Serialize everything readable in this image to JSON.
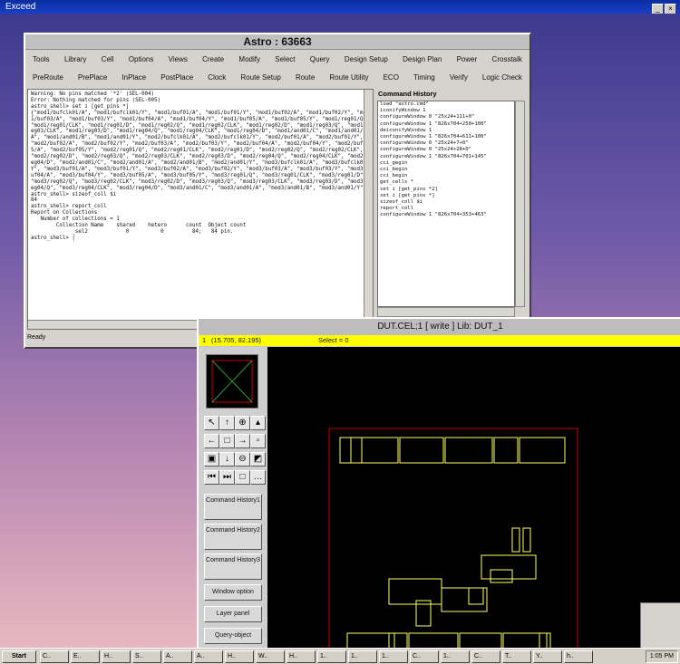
{
  "system_bar": {
    "title": "Exceed"
  },
  "astro": {
    "title": "Astro : 63663",
    "menu_row1": [
      "Tools",
      "Library",
      "Cell",
      "Options",
      "Views",
      "Create",
      "Modify",
      "Select",
      "Query",
      "Design Setup",
      "Design Plan",
      "Power",
      "Crosstalk"
    ],
    "menu_row2": [
      "PreRoute",
      "PrePlace",
      "InPlace",
      "PostPlace",
      "Clock",
      "Route Setup",
      "Route",
      "Route Utility",
      "ECO",
      "Timing",
      "Verify",
      "Logic Check"
    ],
    "console_text": "Warning: No pins matched '*2' (SEL-004)\nError: Nothing matched for pins (SEL-005)\nastro_shell> set i [get_pins *]\n{\"mod1/bufclk01/A\", \"mod1/bufclk01/Y\", \"mod1/buf01/A\", \"mod1/buf01/Y\", \"mod1/buf02/A\", \"mod1/buf02/Y\", \"mod1/buf03/A\", \"mod1/buf03/Y\", \"mod1/buf04/A\", \"mod1/buf04/Y\", \"mod1/buf05/A\", \"mod1/buf05/Y\", \"mod1/reg01/Q\", \"mod1/reg01/CLK\", \"mod1/reg01/D\", \"mod1/reg02/Q\", \"mod1/reg02/CLK\", \"mod1/reg02/D\", \"mod1/reg03/Q\", \"mod1/reg03/CLK\", \"mod1/reg03/D\", \"mod1/reg04/Q\", \"mod1/reg04/CLK\", \"mod1/reg04/D\", \"mod1/and01/C\", \"mod1/and01/A\", \"mod1/and01/B\", \"mod1/and01/Y\", \"mod2/bufclk01/A\", \"mod2/bufclk01/Y\", \"mod2/buf01/A\", \"mod2/buf01/Y\", \"mod2/buf02/A\", \"mod2/buf02/Y\", \"mod2/buf03/A\", \"mod2/buf03/Y\", \"mod2/buf04/A\", \"mod2/buf04/Y\", \"mod2/buf05/A\", \"mod2/buf05/Y\", \"mod2/reg01/Q\", \"mod2/reg01/CLK\", \"mod2/reg01/D\", \"mod2/reg02/Q\", \"mod2/reg02/CLK\", \"mod2/reg02/D\", \"mod2/reg03/Q\", \"mod2/reg03/CLK\", \"mod2/reg03/D\", \"mod2/reg04/Q\", \"mod2/reg04/CLK\", \"mod2/reg04/D\", \"mod2/and01/C\", \"mod2/and01/A\", \"mod2/and01/B\", \"mod2/and01/Y\", \"mod3/bufclk01/A\", \"mod3/bufclk01/Y\", \"mod3/buf01/A\", \"mod3/buf01/Y\", \"mod3/buf02/A\", \"mod3/buf02/Y\", \"mod3/buf03/A\", \"mod3/buf03/Y\", \"mod3/buf04/A\", \"mod3/buf04/Y\", \"mod3/buf05/A\", \"mod3/buf05/Y\", \"mod3/reg01/Q\", \"mod3/reg01/CLK\", \"mod3/reg01/D\", \"mod3/reg02/Q\", \"mod3/reg02/CLK\", \"mod3/reg02/D\", \"mod3/reg03/Q\", \"mod3/reg03/CLK\", \"mod3/reg03/D\", \"mod3/reg04/Q\", \"mod3/reg04/CLK\", \"mod3/reg04/D\", \"mod3/and01/C\", \"mod3/and01/A\", \"mod3/and01/B\", \"mod3/and01/Y\"}\nastro_shell> sizeof_coll $i\n84\nastro_shell> report_coll\nReport on Collections\n   Number of collections = 1\n        Collection Name    shared    hetero      count  Object count\n             _sel2            0          0         84;   84 pin.\nastro_shell> |",
    "history_label": "Command History",
    "history": [
      "load \"astro.cmd\"",
      "iconifyWindow 1",
      "configureWindow 0 \"25x24+111+0\"",
      "configureWindow 1 \"826x704+250+100\"",
      "deiconifyWindow 1",
      "configureWindow 1 \"826x704+611+100\"",
      "configureWindow 0 \"25x24+7+0\"",
      "configureWindow 0 \"25x24+28+0\"",
      "configureWindow 1 \"826x704+701+145\"",
      "cci_gegin",
      "cci_begin",
      "cci_begin",
      "get_cells *",
      "set i [get_pins *2]",
      "set i [get_pins *]",
      "sizeof_coll $i",
      "report_coll",
      "configureWindow 1 \"826x704+353+463\""
    ],
    "status": "Ready"
  },
  "dut": {
    "title": "DUT.CEL;1     [ write ]   Lib: DUT_1",
    "coord": "(15.705, 82.195)",
    "select": "Select = 0",
    "buttons": [
      "Command History1",
      "Command History2",
      "Command History3",
      "Window option",
      "Layer panel",
      "Query-object"
    ]
  },
  "taskbar": {
    "start": "Start",
    "tasks": [
      "C..",
      "E..",
      "H..",
      "S..",
      "A..",
      "A..",
      "H..",
      "W..",
      "H..",
      "1..",
      "1..",
      "1..",
      "C..",
      "1..",
      "C..",
      "T..",
      "Y..",
      "h.."
    ],
    "clock": "1:05 PM"
  },
  "colors": {
    "layout_line": "#ffff66",
    "boundary": "#cc0000"
  }
}
